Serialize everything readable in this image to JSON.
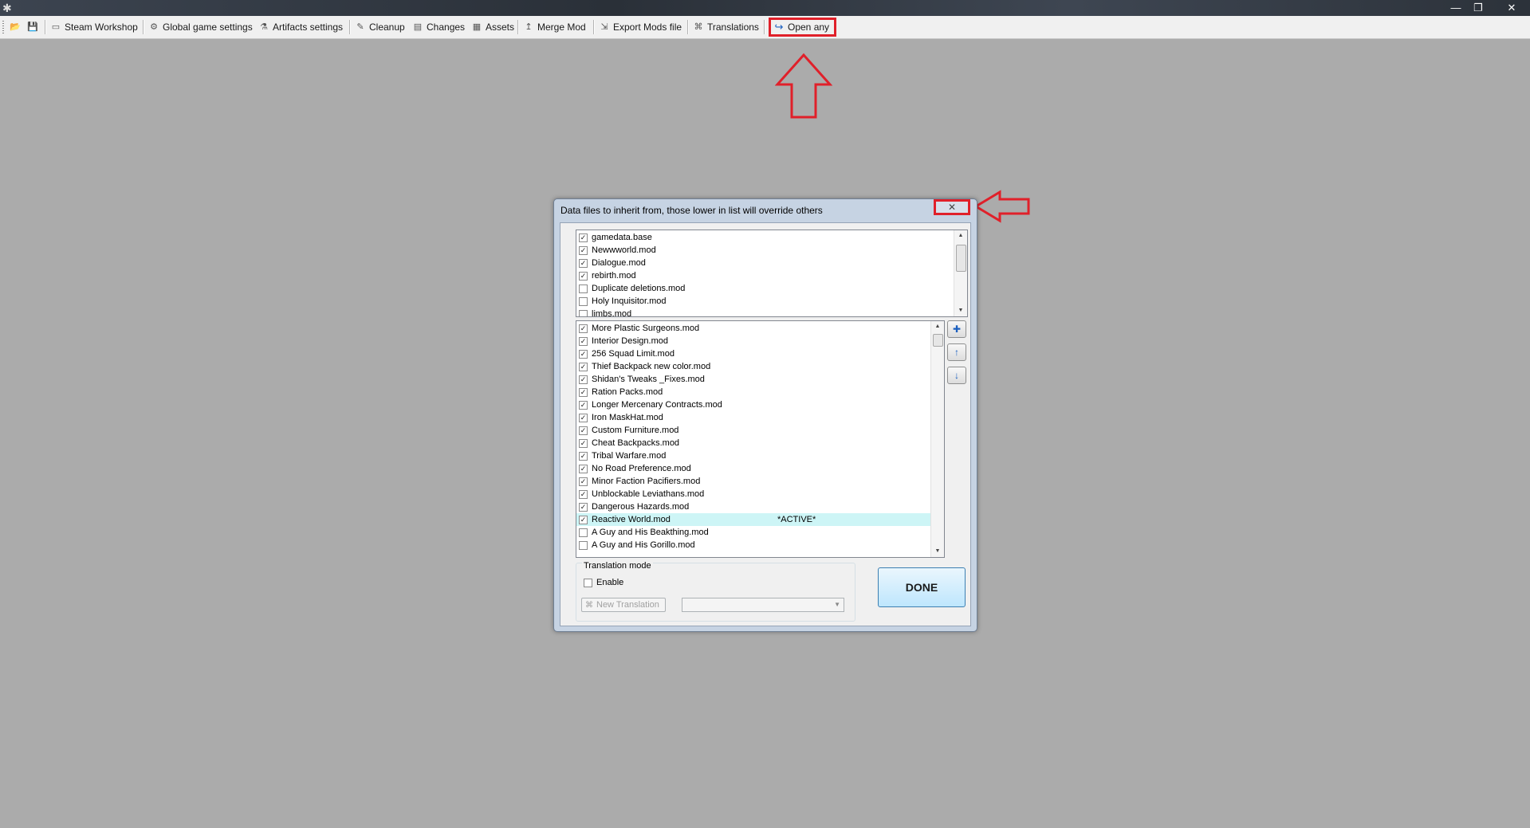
{
  "window": {
    "app_icon": "app-icon",
    "controls": {
      "minimize": "—",
      "maximize": "❐",
      "close": "✕"
    }
  },
  "toolbar": {
    "items": [
      {
        "label": "Steam Workshop",
        "icon": "steam-icon"
      },
      {
        "label": "Global game settings",
        "icon": "gear-icon"
      },
      {
        "label": "Artifacts settings",
        "icon": "artifact-icon"
      },
      {
        "label": "Cleanup",
        "icon": "broom-icon"
      },
      {
        "label": "Changes",
        "icon": "changes-icon"
      },
      {
        "label": "Assets",
        "icon": "assets-icon"
      },
      {
        "label": "Merge Mod",
        "icon": "merge-icon"
      },
      {
        "label": "Export Mods file",
        "icon": "export-icon"
      },
      {
        "label": "Translations",
        "icon": "translations-icon"
      },
      {
        "label": "Open any",
        "icon": "open-arrow-icon"
      }
    ],
    "highlight_color": "#e0202a"
  },
  "dialog": {
    "title": "Data files to inherit from, those lower in list will override others",
    "close_symbol": "✕",
    "top_list": [
      {
        "label": "gamedata.base",
        "checked": true
      },
      {
        "label": "Newwworld.mod",
        "checked": true
      },
      {
        "label": "Dialogue.mod",
        "checked": true
      },
      {
        "label": "rebirth.mod",
        "checked": true
      },
      {
        "label": "Duplicate deletions.mod",
        "checked": false
      },
      {
        "label": "Holy Inquisitor.mod",
        "checked": false
      },
      {
        "label": "limbs.mod",
        "checked": false
      }
    ],
    "bottom_list": [
      {
        "label": "More Plastic Surgeons.mod",
        "checked": true
      },
      {
        "label": "Interior Design.mod",
        "checked": true
      },
      {
        "label": "256 Squad Limit.mod",
        "checked": true
      },
      {
        "label": "Thief Backpack new color.mod",
        "checked": true
      },
      {
        "label": "Shidan's Tweaks _Fixes.mod",
        "checked": true
      },
      {
        "label": "Ration Packs.mod",
        "checked": true
      },
      {
        "label": "Longer Mercenary Contracts.mod",
        "checked": true
      },
      {
        "label": "Iron MaskHat.mod",
        "checked": true
      },
      {
        "label": "Custom Furniture.mod",
        "checked": true
      },
      {
        "label": "Cheat Backpacks.mod",
        "checked": true
      },
      {
        "label": "Tribal Warfare.mod",
        "checked": true
      },
      {
        "label": "No Road Preference.mod",
        "checked": true
      },
      {
        "label": "Minor Faction Pacifiers.mod",
        "checked": true
      },
      {
        "label": "Unblockable Leviathans.mod",
        "checked": true
      },
      {
        "label": "Dangerous Hazards.mod",
        "checked": true
      },
      {
        "label": "Reactive World.mod",
        "checked": true,
        "tag": "*ACTIVE*",
        "active": true
      },
      {
        "label": "A Guy and His Beakthing.mod",
        "checked": false
      },
      {
        "label": "A Guy and His Gorillo.mod",
        "checked": false
      }
    ],
    "side_buttons": [
      "add-file-icon",
      "move-up-icon",
      "move-down-icon"
    ],
    "translation": {
      "legend": "Translation mode",
      "enable_label": "Enable",
      "new_translation_label": "New Translation",
      "combo_value": ""
    },
    "done_label": "DONE"
  }
}
